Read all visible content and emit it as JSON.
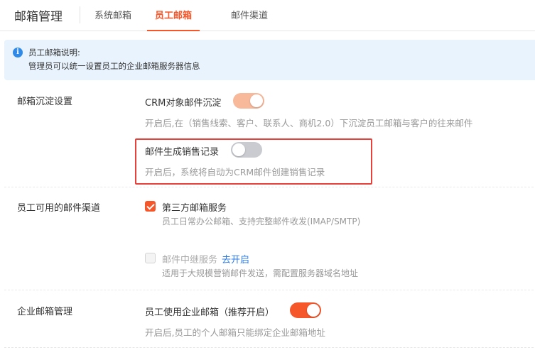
{
  "header": {
    "title": "邮箱管理",
    "tabs": [
      {
        "label": "系统邮箱",
        "active": false
      },
      {
        "label": "员工邮箱",
        "active": true
      },
      {
        "label": "邮件渠道",
        "active": false
      }
    ]
  },
  "notice": {
    "icon": "info-icon",
    "icon_glyph": "i",
    "title": "员工邮箱说明:",
    "desc": "管理员可以统一设置员工的企业邮箱服务器信息"
  },
  "sections": {
    "sediment": {
      "label": "邮箱沉淀设置",
      "crm": {
        "label": "CRM对象邮件沉淀",
        "enabled": true,
        "desc": "开启后,在（销售线索、客户、联系人、商机2.0）下沉淀员工邮箱与客户的往来邮件"
      },
      "sales": {
        "label": "邮件生成销售记录",
        "enabled": false,
        "desc": "开启后，系统将自动为CRM邮件创建销售记录"
      }
    },
    "channels": {
      "label": "员工可用的邮件渠道",
      "third_party": {
        "label": "第三方邮箱服务",
        "checked": true,
        "desc": "员工日常办公邮箱、支持完整邮件收发(IMAP/SMTP)"
      },
      "relay": {
        "label": "邮件中继服务",
        "checked": false,
        "disabled": true,
        "link": "去开启",
        "desc": "适用于大规模营销邮件发送，需配置服务器域名地址"
      }
    },
    "enterprise": {
      "label": "企业邮箱管理",
      "use_enterprise": {
        "label": "员工使用企业邮箱（推荐开启）",
        "enabled": true,
        "desc": "开启后,员工的个人邮箱只能绑定企业邮箱地址"
      }
    }
  },
  "colors": {
    "accent": "#f5562a",
    "accent_light": "#f8b89a",
    "info_blue": "#2e8ae6",
    "highlight_red": "#e8413c"
  }
}
